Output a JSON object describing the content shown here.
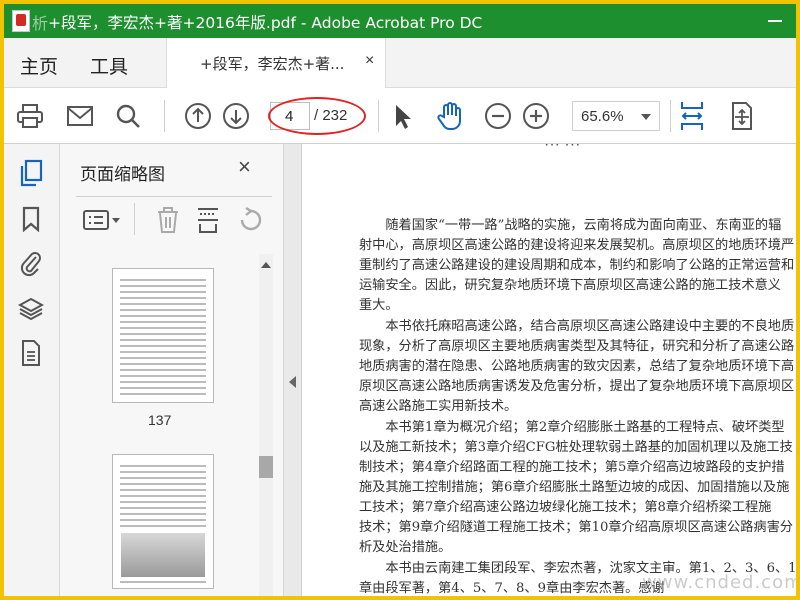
{
  "window": {
    "title": "+段军，李宏杰+著+2016年版.pdf - Adobe Acrobat Pro DC",
    "watermark_left": "析"
  },
  "menu": {
    "home": "主页",
    "tools": "工具"
  },
  "document_tab": {
    "label": "+段军，李宏杰+著...",
    "close": "×"
  },
  "toolbar": {
    "page_current": "4",
    "page_total": "/ 232",
    "zoom": "65.6%",
    "icons": [
      "print-icon",
      "mail-icon",
      "search-icon",
      "page-up-icon",
      "page-down-icon",
      "select-arrow-icon",
      "hand-icon",
      "zoom-out-icon",
      "zoom-in-icon",
      "fit-width-icon",
      "scroll-mode-icon"
    ]
  },
  "left_nav": {
    "icons": [
      "page-thumbnails-icon",
      "bookmark-icon",
      "attachment-icon",
      "layers-icon",
      "document-properties-icon"
    ]
  },
  "thumbnail_panel": {
    "title": "页面缩略图",
    "close": "×",
    "tools": [
      "thumbnail-options-icon",
      "delete-page-icon",
      "extract-page-icon",
      "rotate-page-icon"
    ],
    "thumbnails": [
      {
        "label": "137"
      },
      {
        "label": ""
      }
    ]
  },
  "document": {
    "top_fragment": "··· ···",
    "paragraphs": [
      "　　随着国家“一带一路”战略的实施，云南将成为面向南亚、东南亚的辐",
      "射中心，高原坝区高速公路的建设将迎来发展契机。高原坝区的地质环境严",
      "重制约了高速公路建设的建设周期和成本，制约和影响了公路的正常运营和",
      "运输安全。因此，研究复杂地质环境下高原坝区高速公路的施工技术意义",
      "重大。",
      "　　本书依托麻昭高速公路，结合高原坝区高速公路建设中主要的不良地质",
      "现象，分析了高原坝区主要地质病害类型及其特征，研究和分析了高速公路",
      "地质病害的潜在隐患、公路地质病害的致灾因素，总结了复杂地质环境下高",
      "原坝区高速公路地质病害诱发及危害分析，提出了复杂地质环境下高原坝区",
      "高速公路施工实用新技术。",
      "　　本书第1章为概况介绍；第2章介绍膨胀土路基的工程特点、破坏类型",
      "以及施工新技术；第3章介绍CFG桩处理软弱土路基的加固机理以及施工技",
      "制技术；第4章介绍路面工程的施工技术；第5章介绍高边坡路段的支护措",
      "施及其施工控制措施；第6章介绍膨胀土路堑边坡的成因、加固措施以及施",
      "工技术；第7章介绍高速公路边坡绿化施工技术；第8章介绍桥梁工程施",
      "技术；第9章介绍隧道工程施工技术；第10章介绍高原坝区高速公路病害分",
      "析及处治措施。",
      "　　本书由云南建工集团段军、李宏杰著，沈家文主审。第1、2、3、6、1",
      "章由段军著，第4、5、7、8、9章由李宏杰著。感谢"
    ],
    "watermark": "www.cnded.com"
  }
}
